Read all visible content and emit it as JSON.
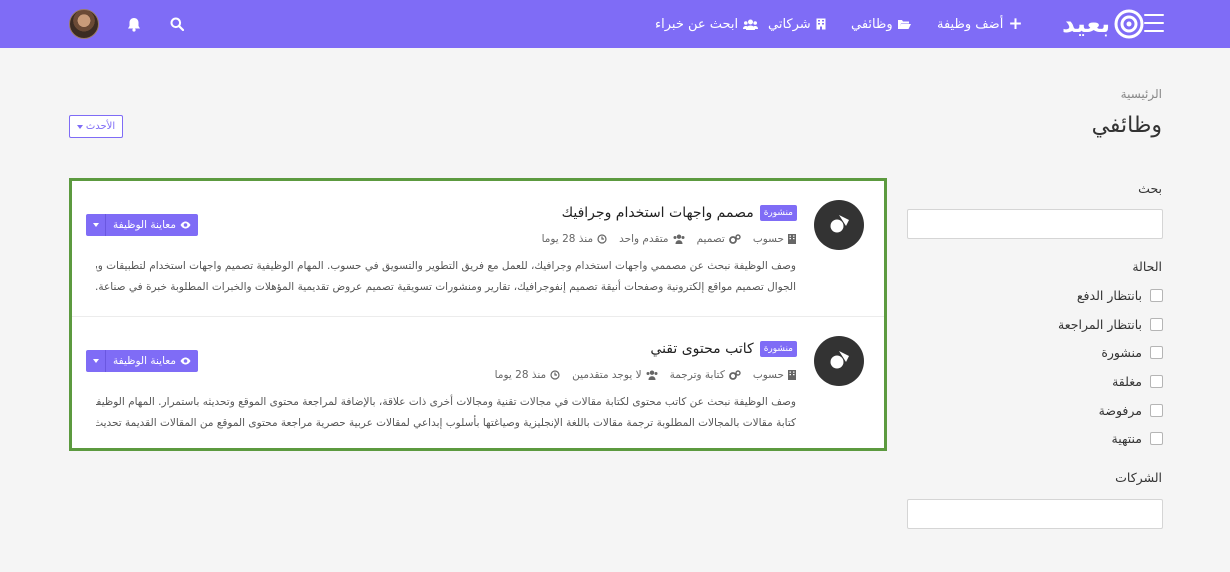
{
  "navbar": {
    "logo_text": "بعيد",
    "items": {
      "post_job": "أضف وظيفة",
      "my_jobs": "وظائفي",
      "my_companies": "شركاتي",
      "find_experts": "ابحث عن خبراء"
    },
    "colors": {
      "primary": "#7f6cf6"
    }
  },
  "header": {
    "breadcrumb": "الرئيسية",
    "title": "وظائفي",
    "sort_label": "الأحدث"
  },
  "sidebar": {
    "search_label": "بحث",
    "status_label": "الحالة",
    "statuses": [
      "بانتظار الدفع",
      "بانتظار المراجعة",
      "منشورة",
      "مغلقة",
      "مرفوضة",
      "منتهية"
    ],
    "companies_label": "الشركات"
  },
  "jobs": [
    {
      "badge": "منشورة",
      "title": "مصمم واجهات استخدام وجرافيك",
      "company": "حسوب",
      "category": "تصميم",
      "level": "متقدم واحد",
      "time": "منذ 28 يوما",
      "desc_line1": "وصف الوظيفة نبحث عن مصممي واجهات استخدام وجرافيك، للعمل مع فريق التطوير والتسويق في حسوب. المهام الوظيفية تصميم واجهات استخدام لتطبيقات ويب",
      "desc_line2": "الجوال تصميم مواقع إلكترونية وصفحات أنيقة تصميم إنفوجرافيك، تقارير ومنشورات تسويقية تصميم عروض تقديمية المؤهلات والخبرات المطلوبة خبرة في صناعة...",
      "view_label": "معاينة الوظيفة"
    },
    {
      "badge": "منشورة",
      "title": "كاتب محتوى تقني",
      "company": "حسوب",
      "category": "كتابة وترجمة",
      "level": "لا يوجد متقدمين",
      "time": "منذ 28 يوما",
      "desc_line1": "وصف الوظيفة نبحث عن كاتب محتوى لكتابة مقالات في مجالات تقنية ومجالات أخرى ذات علاقة، بالإضافة لمراجعة محتوى الموقع وتحديثه باستمرار. المهام الوظيفية",
      "desc_line2": "كتابة مقالات بالمجالات المطلوبة ترجمة مقالات باللغة الإنجليزية وصياغتها بأسلوب إبداعي لمقالات عربية حصرية مراجعة محتوى الموقع من المقالات القديمة تحديث...",
      "view_label": "معاينة الوظيفة"
    }
  ]
}
